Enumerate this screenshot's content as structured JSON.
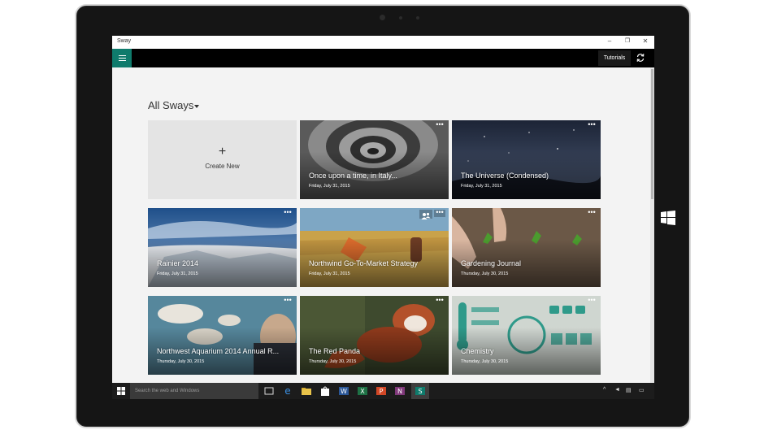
{
  "window": {
    "title": "Sway"
  },
  "appbar": {
    "tutorials_label": "Tutorials"
  },
  "main": {
    "heading": "All Sways"
  },
  "create_new": {
    "label": "Create New"
  },
  "cards": [
    {
      "title": "Once upon a time, in Italy...",
      "date": "Friday, July 31, 2015"
    },
    {
      "title": "The Universe (Condensed)",
      "date": "Friday, July 31, 2015"
    },
    {
      "title": "Rainier 2014",
      "date": "Friday, July 31, 2015"
    },
    {
      "title": "Northwind Go-To-Market Strategy",
      "date": "Friday, July 31, 2015"
    },
    {
      "title": "Gardening Journal",
      "date": "Thursday, July 30, 2015"
    },
    {
      "title": "Northwest Aquarium 2014 Annual R...",
      "date": "Thursday, July 30, 2015"
    },
    {
      "title": "The Red Panda",
      "date": "Thursday, July 30, 2015"
    },
    {
      "title": "Chemistry",
      "date": "Thursday, July 30, 2015"
    }
  ],
  "taskbar": {
    "search_placeholder": "Search the web and Windows"
  },
  "icons": {
    "menu": "hamburger-icon",
    "sync": "sync-icon",
    "more": "more-icon",
    "share": "people-icon",
    "start": "windows-logo-icon"
  },
  "colors": {
    "accent": "#0f7b6c",
    "appbar": "#000000",
    "taskbar": "#1c1c1c"
  }
}
